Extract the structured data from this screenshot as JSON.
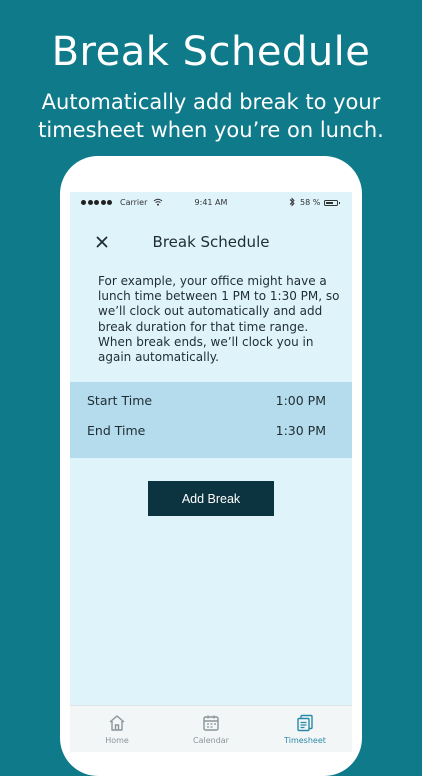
{
  "promo": {
    "headline": "Break Schedule",
    "subhead_line1": "Automatically add break to your",
    "subhead_line2": "timesheet when you’re on lunch."
  },
  "status_bar": {
    "carrier": "Carrier",
    "time": "9:41 AM",
    "battery": "58 %"
  },
  "nav": {
    "title": "Break Schedule",
    "close_icon": "close-icon"
  },
  "description": "For example, your office might have a lunch time between 1 PM to 1:30 PM, so we’ll clock out automatically and add break duration for that time range. When break ends, we’ll clock you in again automatically.",
  "break_times": [
    {
      "label": "Start Time",
      "value": "1:00 PM"
    },
    {
      "label": "End Time",
      "value": "1:30 PM"
    }
  ],
  "add_button": "Add Break",
  "tabs": [
    {
      "label": "Home",
      "icon": "home-icon",
      "active": false
    },
    {
      "label": "Calendar",
      "icon": "calendar-icon",
      "active": false
    },
    {
      "label": "Timesheet",
      "icon": "timesheet-icon",
      "active": true
    }
  ],
  "colors": {
    "background": "#0f7a8a",
    "screen": "#dff3fb",
    "time_rows": "#b4dcec",
    "button": "#0c3440",
    "active_tab": "#2a8aa8"
  }
}
